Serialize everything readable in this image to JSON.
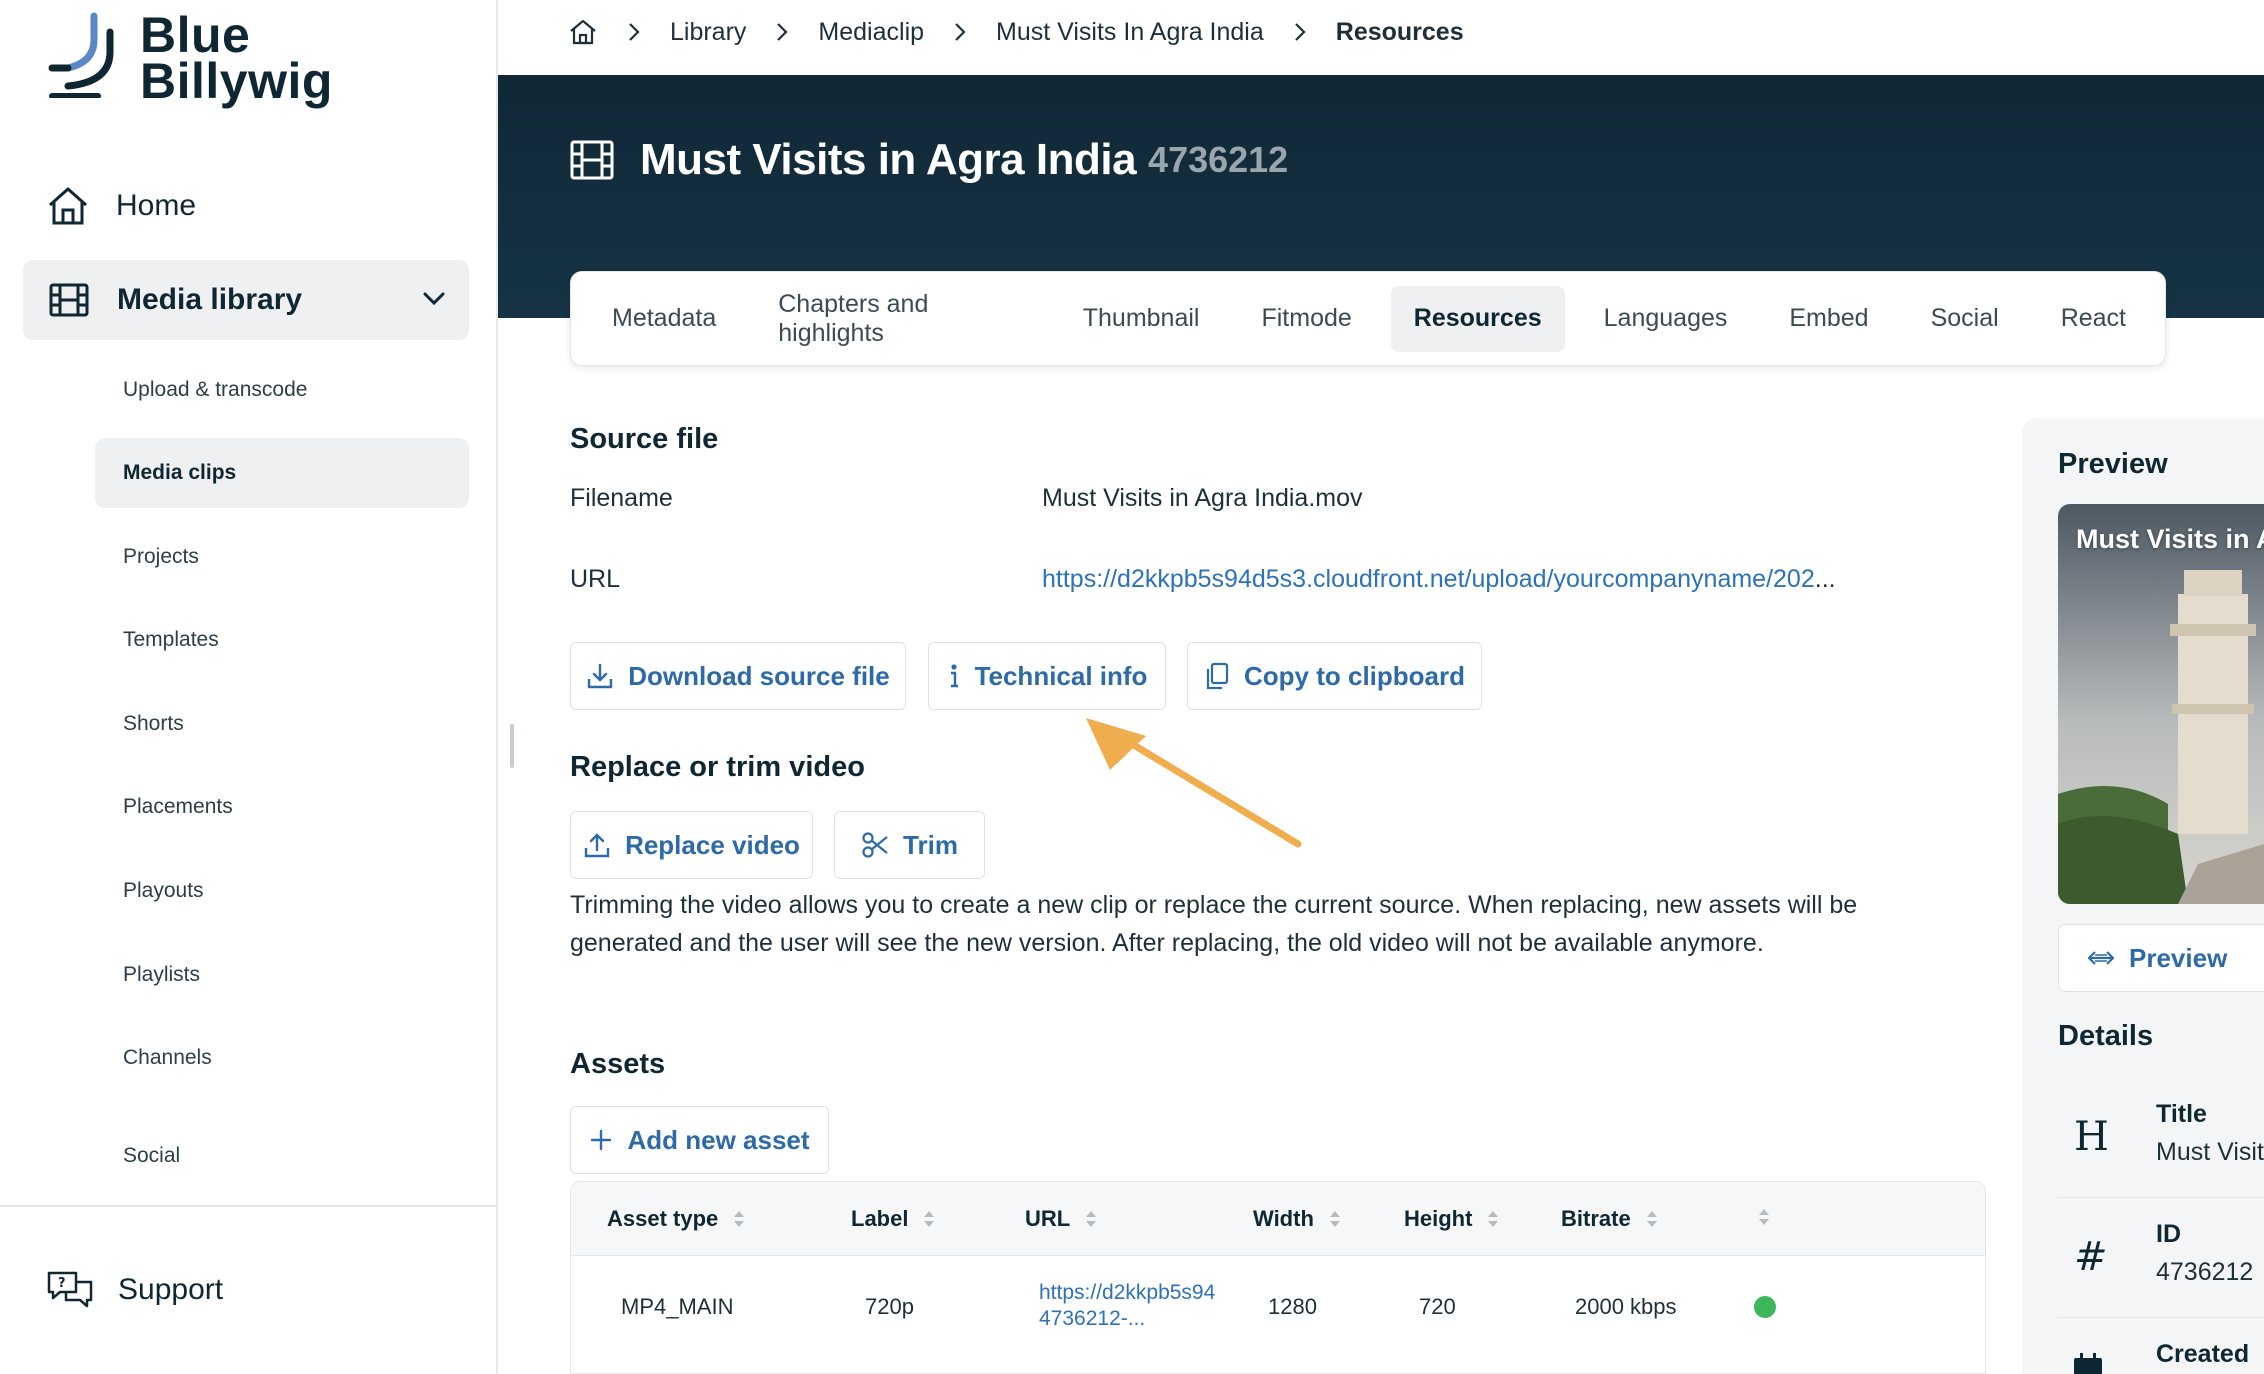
{
  "brand": {
    "line1": "Blue",
    "line2": "Billywig"
  },
  "sidebar": {
    "home": "Home",
    "media_library": "Media library",
    "items": [
      {
        "label": "Upload & transcode"
      },
      {
        "label": "Media clips"
      },
      {
        "label": "Projects"
      },
      {
        "label": "Templates"
      },
      {
        "label": "Shorts"
      },
      {
        "label": "Placements"
      },
      {
        "label": "Playouts"
      },
      {
        "label": "Playlists"
      },
      {
        "label": "Channels"
      },
      {
        "label": "Social"
      }
    ],
    "active_item": "Media clips",
    "support": "Support"
  },
  "breadcrumb": {
    "items": [
      "Library",
      "Mediaclip",
      "Must Visits In Agra India"
    ],
    "current": "Resources"
  },
  "header": {
    "title": "Must Visits in Agra India",
    "id": "4736212"
  },
  "tabs": [
    "Metadata",
    "Chapters and highlights",
    "Thumbnail",
    "Fitmode",
    "Resources",
    "Languages",
    "Embed",
    "Social",
    "React"
  ],
  "active_tab": "Resources",
  "source_file": {
    "heading": "Source file",
    "filename_label": "Filename",
    "filename_value": "Must Visits in Agra India.mov",
    "url_label": "URL",
    "url_value": "https://d2kkpb5s94d5s3.cloudfront.net/upload/yourcompanyname/202",
    "url_ellipsis": "...",
    "buttons": {
      "download": "Download source file",
      "technical": "Technical info",
      "copy": "Copy to clipboard"
    }
  },
  "replace": {
    "heading": "Replace or trim video",
    "replace_button": "Replace video",
    "trim_button": "Trim",
    "description": "Trimming the video allows you to create a new clip or replace the current source. When replacing, new assets will be generated and the user will see the new version. After replacing, the old video will not be available anymore."
  },
  "assets": {
    "heading": "Assets",
    "add_button": "Add new asset",
    "columns": [
      "Asset type",
      "Label",
      "URL",
      "Width",
      "Height",
      "Bitrate"
    ],
    "rows": [
      {
        "type": "MP4_MAIN",
        "label": "720p",
        "url_line1": "https://d2kkpb5s94",
        "url_line2": "4736212-...",
        "width": "1280",
        "height": "720",
        "bitrate": "2000 kbps",
        "status_color": "#3cb55b"
      }
    ]
  },
  "right_panel": {
    "preview_heading": "Preview",
    "preview_caption": "Must Visits in A",
    "preview_button": "Preview",
    "details_heading": "Details",
    "details": [
      {
        "icon": "H",
        "key": "Title",
        "value": "Must Visits"
      },
      {
        "icon": "#",
        "key": "ID",
        "value": "4736212"
      },
      {
        "icon": "calendar",
        "key": "Created",
        "value": ""
      }
    ]
  },
  "colors": {
    "accent": "#2d6aa8",
    "link": "#2d72b8",
    "hero": "#102735",
    "arrow": "#f0ad4e",
    "status_ok": "#3cb55b"
  }
}
